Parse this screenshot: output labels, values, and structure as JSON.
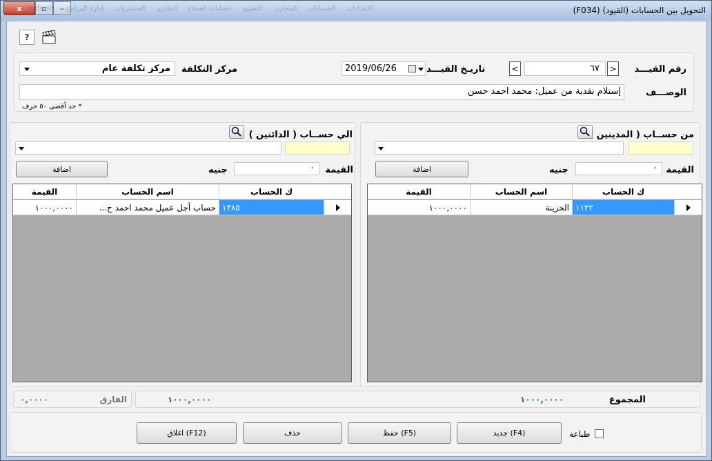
{
  "window": {
    "title": "(F034)  التحويل بين الحسابات (القيود)",
    "menu_faint": [
      "الإعدادات",
      "الحسابات",
      "المخازن",
      "التصنيع",
      "حسابات العملاء",
      "التقارير",
      "المشتريات",
      "إدارة البرنامج",
      "Refresh"
    ],
    "close_label": "x",
    "max_label": "▫",
    "min_label": "‒"
  },
  "toolbar": {
    "help_label": "?"
  },
  "header": {
    "entry_no_label": "رقم القيـــد",
    "entry_no_value": "٦٧",
    "prev_label": "<",
    "next_label": ">",
    "date_label": "تاريـخ القيـــد",
    "date_value": "2019/06/26",
    "cost_center_label": "مركز التكلفة",
    "cost_center_value": "مركز تكلفة عام",
    "description_label": "الوصـــف",
    "description_value": "إستلام نقدية من عميل: محمد احمد حسن",
    "hint": "* حد أقصى ٥٠ حرف"
  },
  "debit": {
    "title": "من حســاب ( المدينين )",
    "amount_label": "القيمة",
    "amount_value": "٠",
    "currency": "جنيه",
    "add_label": "اضافة",
    "columns": [
      "ك الحساب",
      "اسم الحساب",
      "القيمة"
    ],
    "rows": [
      {
        "code": "١١٢٢",
        "name": "الخزينة",
        "value": "١٠٠٠,٠٠٠٠"
      }
    ]
  },
  "credit": {
    "title": "الي حســاب ( الدائنين )",
    "amount_label": "القيمة",
    "amount_value": "٠",
    "currency": "جنيه",
    "add_label": "اضافة",
    "columns": [
      "ك الحساب",
      "اسم الحساب",
      "القيمة"
    ],
    "rows": [
      {
        "code": "١٣٨٥",
        "name": "حساب أجل عميل محمد احمد ح...",
        "value": "١٠٠٠,٠٠٠٠"
      }
    ]
  },
  "totals": {
    "total_label": "المجموع",
    "debit_total": "١٠٠٠,٠٠٠٠",
    "credit_total": "١٠٠٠,٠٠٠٠",
    "diff_label": "الفارق",
    "diff_value": "٠,٠٠٠٠"
  },
  "footer": {
    "print_label": "طباعة",
    "new_label": "جديد (F4)",
    "save_label": "حفظ (F5)",
    "delete_label": "حذف",
    "close_label": "اغلاق (F12)"
  },
  "colors": {
    "selection": "#3399ff",
    "totals_green": "#1f8a1f",
    "required_yellow": "#ffffcc",
    "grid_bg": "#ababab"
  }
}
